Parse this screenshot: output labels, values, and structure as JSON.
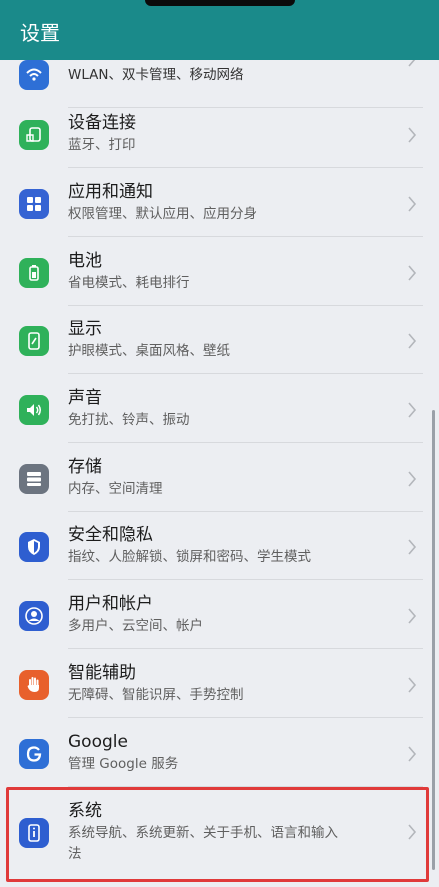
{
  "header": {
    "title": "设置"
  },
  "items": [
    {
      "title": "",
      "subtitle": "WLAN、双卡管理、移动网络",
      "icon": "wifi-icon",
      "color": "#2e6fd6"
    },
    {
      "title": "设备连接",
      "subtitle": "蓝牙、打印",
      "icon": "device-connection-icon",
      "color": "#2fb15a"
    },
    {
      "title": "应用和通知",
      "subtitle": "权限管理、默认应用、应用分身",
      "icon": "apps-grid-icon",
      "color": "#3563d3"
    },
    {
      "title": "电池",
      "subtitle": "省电模式、耗电排行",
      "icon": "battery-icon",
      "color": "#2fb15a"
    },
    {
      "title": "显示",
      "subtitle": "护眼模式、桌面风格、壁纸",
      "icon": "display-icon",
      "color": "#2fb15a"
    },
    {
      "title": "声音",
      "subtitle": "免打扰、铃声、振动",
      "icon": "speaker-icon",
      "color": "#2fb15a"
    },
    {
      "title": "存储",
      "subtitle": "内存、空间清理",
      "icon": "storage-icon",
      "color": "#6c7480"
    },
    {
      "title": "安全和隐私",
      "subtitle": "指纹、人脸解锁、锁屏和密码、学生模式",
      "icon": "shield-icon",
      "color": "#2e5ed0"
    },
    {
      "title": "用户和帐户",
      "subtitle": "多用户、云空间、帐户",
      "icon": "user-icon",
      "color": "#2e5ed0"
    },
    {
      "title": "智能辅助",
      "subtitle": "无障碍、智能识屏、手势控制",
      "icon": "hand-icon",
      "color": "#e8602c"
    },
    {
      "title": "Google",
      "subtitle": "管理 Google 服务",
      "icon": "google-icon",
      "color": "#2e6fd6"
    },
    {
      "title": "系统",
      "subtitle": "系统导航、系统更新、关于手机、语言和输入",
      "subtitle2": "法",
      "icon": "system-icon",
      "color": "#2e5ed0"
    }
  ]
}
